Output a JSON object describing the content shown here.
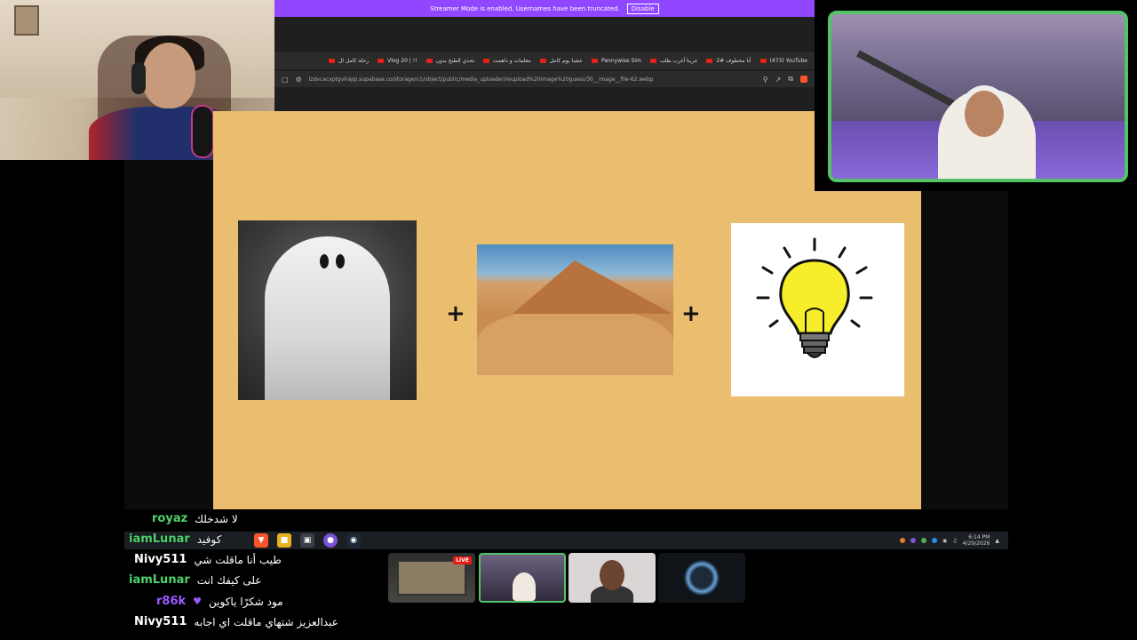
{
  "browser": {
    "streamer_banner_text": "Streamer Mode is enabled. Usernames have been truncated.",
    "streamer_banner_button": "Disable",
    "tabs": [
      {
        "label": "(473) YouTube"
      },
      {
        "label": "أنا مخطوف #2"
      },
      {
        "label": "جربنا أغرب طلب"
      },
      {
        "label": "Pennywise Sim"
      },
      {
        "label": "عشنا يوم كامل"
      },
      {
        "label": "معلمات و داهمت"
      },
      {
        "label": "تحدي الطبخ بدون"
      },
      {
        "label": "Vlog 20 | !!"
      },
      {
        "label": "رحلة كامل ال"
      }
    ],
    "url": "lzdvcacxptgvlrajqi.supabase.co/storage/v1/object/public/media_uploader/reupload%20image%20guess/30__image__file-62.webp"
  },
  "puzzle": {
    "plus_symbol": "+",
    "images": [
      {
        "name": "ghost"
      },
      {
        "name": "desert"
      },
      {
        "name": "lightbulb"
      }
    ]
  },
  "taskbar": {
    "time": "6:14 PM",
    "date": "4/29/2026"
  },
  "chat": [
    {
      "user": "royaz",
      "color": "#4fd26b",
      "message": "لا شدخلك"
    },
    {
      "user": "iamLunar",
      "color": "#4fd26b",
      "message": "كوفيد"
    },
    {
      "user": "Nivy511",
      "color": "#ffffff",
      "message": "طيب أنا ماقلت شي"
    },
    {
      "user": "iamLunar",
      "color": "#4fd26b",
      "message": "على كيفك انت"
    },
    {
      "user": "r86k",
      "color": "#9b59ff",
      "message": "مود شكرًا ياكوين"
    },
    {
      "user": "Nivy511",
      "color": "#ffffff",
      "message": "عبدالعزيز شتهاي ماقلت اي اجابه"
    }
  ],
  "camstrip": {
    "live_badge": "LIVE"
  }
}
